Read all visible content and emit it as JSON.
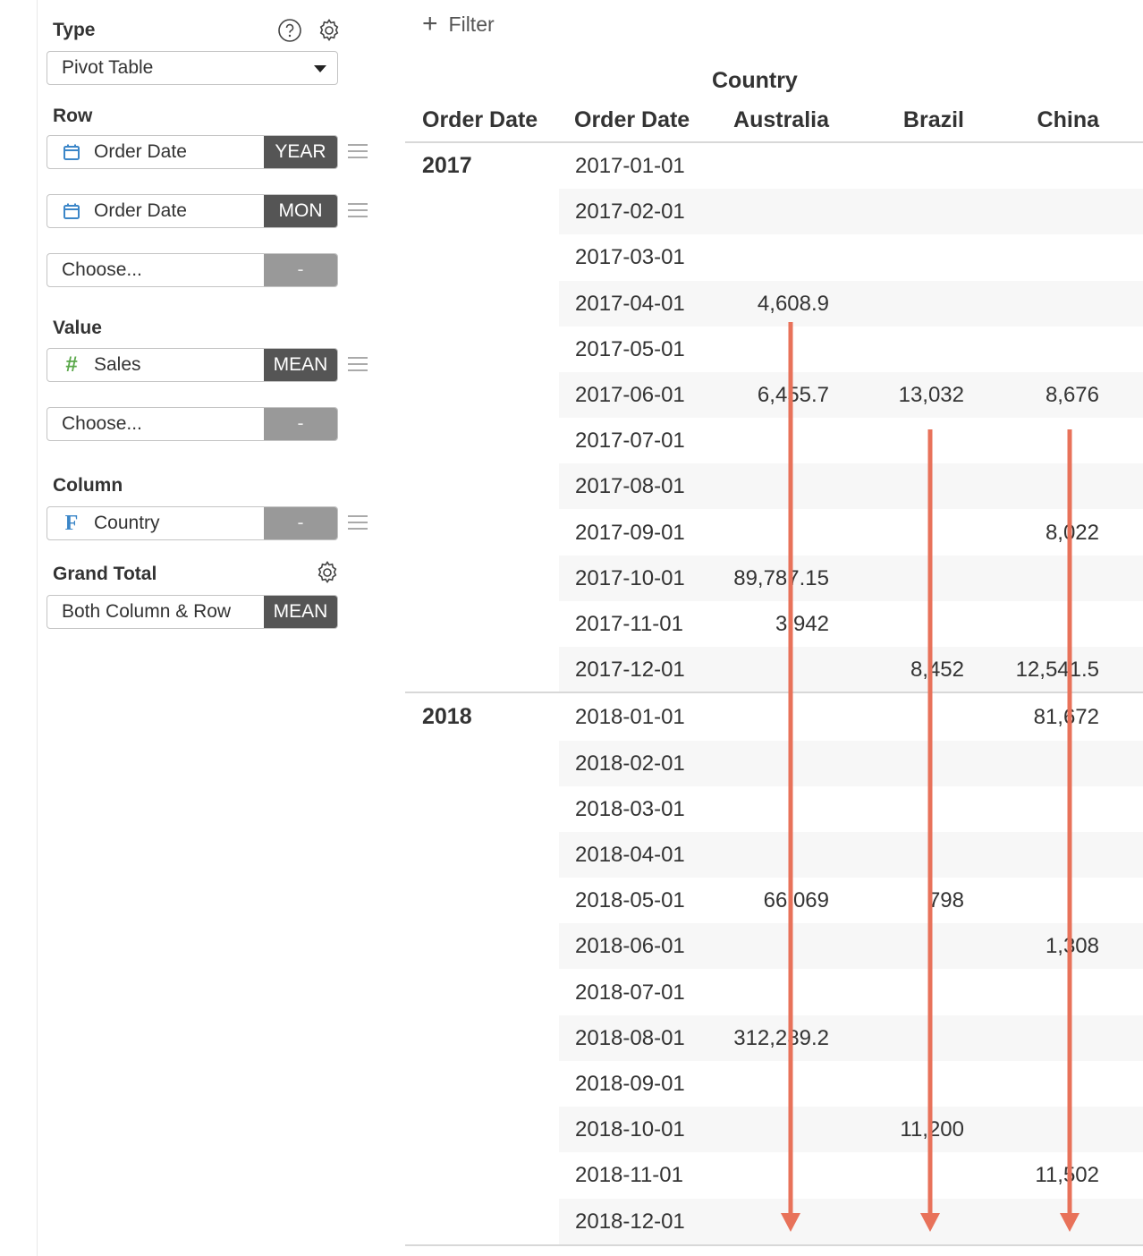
{
  "sidebar": {
    "type_title": "Type",
    "type_value": "Pivot Table",
    "row_title": "Row",
    "row_fields": [
      {
        "name": "Order Date",
        "tag": "YEAR",
        "icon": "calendar-icon"
      },
      {
        "name": "Order Date",
        "tag": "MON",
        "icon": "calendar-icon"
      },
      {
        "name": "Choose...",
        "tag": "-"
      }
    ],
    "value_title": "Value",
    "value_fields": [
      {
        "name": "Sales",
        "tag": "MEAN",
        "icon": "number-hash-icon"
      },
      {
        "name": "Choose...",
        "tag": "-"
      }
    ],
    "column_title": "Column",
    "column_field": {
      "name": "Country",
      "tag": "-",
      "icon": "factor-icon"
    },
    "grand_total_title": "Grand Total",
    "grand_total": {
      "name": "Both Column & Row",
      "tag": "MEAN"
    }
  },
  "main": {
    "filter_label": "Filter",
    "column_group_header": "Country",
    "headers": [
      "Order Date",
      "Order Date",
      "Australia",
      "Brazil",
      "China"
    ],
    "groups": [
      {
        "year": "2017",
        "rows": [
          {
            "date": "2017-01-01",
            "australia": "",
            "brazil": "",
            "china": ""
          },
          {
            "date": "2017-02-01",
            "australia": "",
            "brazil": "",
            "china": ""
          },
          {
            "date": "2017-03-01",
            "australia": "",
            "brazil": "",
            "china": ""
          },
          {
            "date": "2017-04-01",
            "australia": "4,608.9",
            "brazil": "",
            "china": ""
          },
          {
            "date": "2017-05-01",
            "australia": "",
            "brazil": "",
            "china": ""
          },
          {
            "date": "2017-06-01",
            "australia": "6,455.7",
            "brazil": "13,032",
            "china": "8,676"
          },
          {
            "date": "2017-07-01",
            "australia": "",
            "brazil": "",
            "china": ""
          },
          {
            "date": "2017-08-01",
            "australia": "",
            "brazil": "",
            "china": ""
          },
          {
            "date": "2017-09-01",
            "australia": "",
            "brazil": "",
            "china": "8,022"
          },
          {
            "date": "2017-10-01",
            "australia": "89,787.15",
            "brazil": "",
            "china": ""
          },
          {
            "date": "2017-11-01",
            "australia": "3,942",
            "brazil": "",
            "china": ""
          },
          {
            "date": "2017-12-01",
            "australia": "",
            "brazil": "8,452",
            "china": "12,541.5"
          }
        ]
      },
      {
        "year": "2018",
        "rows": [
          {
            "date": "2018-01-01",
            "australia": "",
            "brazil": "",
            "china": "81,672"
          },
          {
            "date": "2018-02-01",
            "australia": "",
            "brazil": "",
            "china": ""
          },
          {
            "date": "2018-03-01",
            "australia": "",
            "brazil": "",
            "china": ""
          },
          {
            "date": "2018-04-01",
            "australia": "",
            "brazil": "",
            "china": ""
          },
          {
            "date": "2018-05-01",
            "australia": "66,069",
            "brazil": "798",
            "china": ""
          },
          {
            "date": "2018-06-01",
            "australia": "",
            "brazil": "",
            "china": "1,308"
          },
          {
            "date": "2018-07-01",
            "australia": "",
            "brazil": "",
            "china": ""
          },
          {
            "date": "2018-08-01",
            "australia": "312,289.2",
            "brazil": "",
            "china": ""
          },
          {
            "date": "2018-09-01",
            "australia": "",
            "brazil": "",
            "china": ""
          },
          {
            "date": "2018-10-01",
            "australia": "",
            "brazil": "11,200",
            "china": ""
          },
          {
            "date": "2018-11-01",
            "australia": "",
            "brazil": "",
            "china": "11,502"
          },
          {
            "date": "2018-12-01",
            "australia": "",
            "brazil": "",
            "china": ""
          }
        ]
      }
    ]
  },
  "colors": {
    "arrow": "#e8725a",
    "tag_dark": "#555555",
    "tag_empty": "#999999",
    "calendar_icon": "#3b86c8",
    "hash_icon": "#5aa84a"
  }
}
